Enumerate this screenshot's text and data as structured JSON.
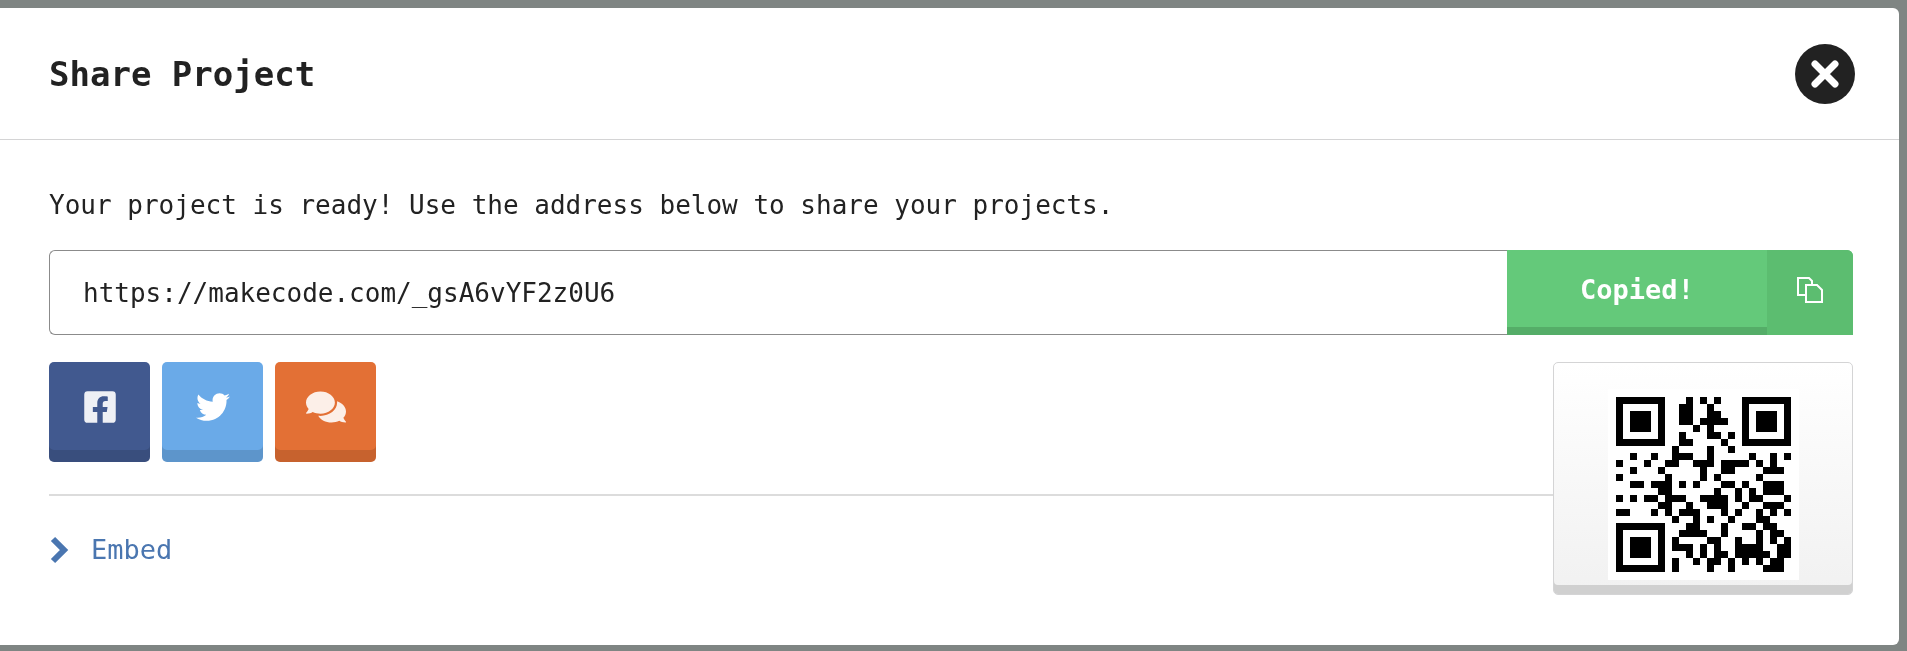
{
  "dialog": {
    "title": "Share Project",
    "message": "Your project is ready! Use the address below to share your projects.",
    "url_field": {
      "value": "https://makecode.com/_gsA6vYF2z0U6"
    },
    "copy_button": {
      "label": "Copied!",
      "copied": true
    },
    "social_buttons": [
      {
        "kind": "facebook",
        "color": "#41598f"
      },
      {
        "kind": "twitter",
        "color": "#6aaae8"
      },
      {
        "kind": "forum",
        "color": "#e37035"
      }
    ],
    "embed": {
      "label": "Embed",
      "expanded": false
    }
  }
}
